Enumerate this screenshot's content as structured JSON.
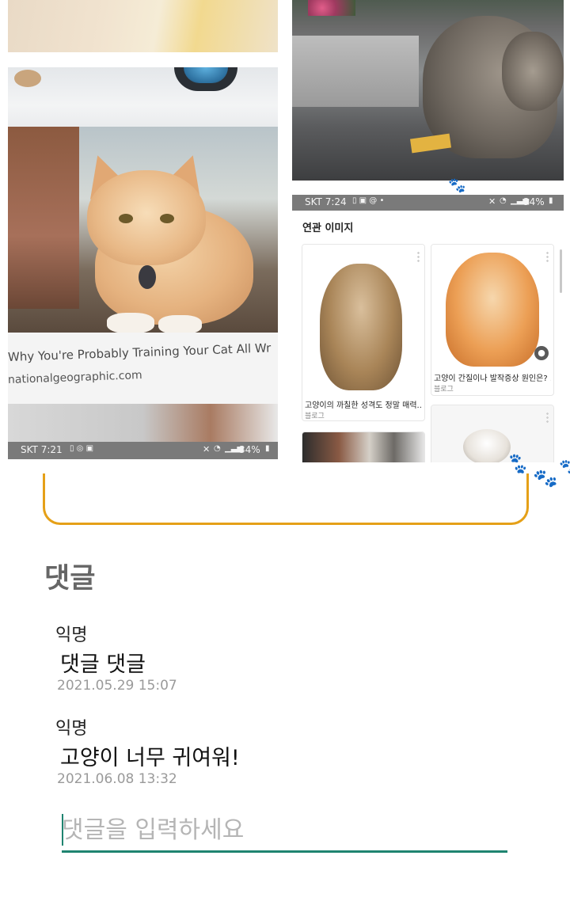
{
  "left_screenshot": {
    "status_bar": {
      "carrier_time": "SKT 7:21",
      "battery": "34%"
    },
    "article_title": "Why You're Probably Training Your Cat All Wr",
    "article_source": "nationalgeographic.com"
  },
  "right_screenshot": {
    "status_bar": {
      "carrier_time": "SKT 7:24",
      "battery": "34%"
    },
    "related_title": "연관 이미지",
    "results": [
      {
        "caption": "고양이의 까칠한 성격도 정말 매력...",
        "source": "블로그"
      },
      {
        "caption": "고양이 간질이나 발작증상 원인은? ...",
        "source": "블로그"
      }
    ]
  },
  "comments": {
    "title": "댓글",
    "items": [
      {
        "author": "익명",
        "text": "댓글 댓글",
        "date": "2021.05.29 15:07"
      },
      {
        "author": "익명",
        "text": "고양이 너무 귀여워!",
        "date": "2021.06.08 13:32"
      }
    ],
    "input": {
      "placeholder": "댓글을 입력하세요",
      "value": ""
    }
  },
  "colors": {
    "frame_accent": "#e5a018",
    "input_underline": "#1f8470",
    "paw": "#eaa82a"
  },
  "icons": [
    "paw-print-icon",
    "location-pin-icon",
    "mute-icon",
    "wifi-icon",
    "signal-icon",
    "battery-icon",
    "more-vert-icon"
  ]
}
